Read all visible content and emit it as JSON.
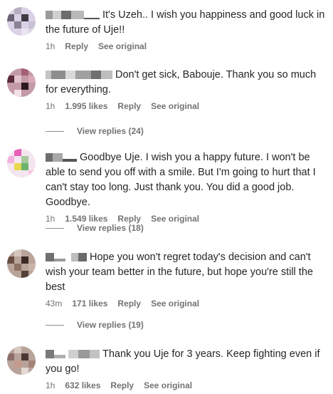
{
  "comments": [
    {
      "text": "It's Uzeh.. I wish you happiness and good luck in the future of Uje!!",
      "time": "1h",
      "likes": "",
      "reply": "Reply",
      "see_original": "See original",
      "view_replies": ""
    },
    {
      "text": "Don't get sick, Babouje. Thank you so much for everything.",
      "time": "1h",
      "likes": "1.995 likes",
      "reply": "Reply",
      "see_original": "See original",
      "view_replies": "View replies (24)"
    },
    {
      "text": "Goodbye Uje. I wish you a happy future. I won't be able to send you off with a smile. But I'm going to hurt that I can't stay too long. Just thank you. You did a good job. Goodbye.",
      "time": "1h",
      "likes": "1.549 likes",
      "reply": "Reply",
      "see_original": "See original",
      "view_replies": "View replies (18)"
    },
    {
      "text": "Hope you won't regret today's decision and can't wish your team better in the future, but hope you're still the best",
      "time": "43m",
      "likes": "171 likes",
      "reply": "Reply",
      "see_original": "See original",
      "view_replies": "View replies (19)"
    },
    {
      "text": "Thank you Uje for 3 years. Keep fighting even if you go!",
      "time": "1h",
      "likes": "632 likes",
      "reply": "Reply",
      "see_original": "See original",
      "view_replies": ""
    }
  ]
}
